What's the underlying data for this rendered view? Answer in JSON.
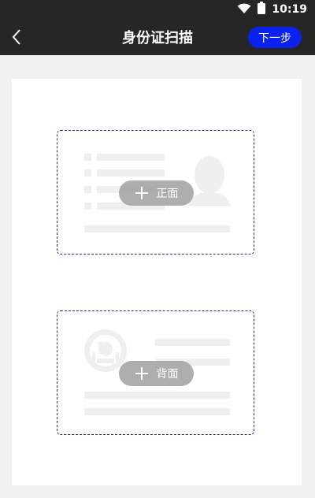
{
  "status": {
    "time": "10:19",
    "wifi_icon": "wifi-icon",
    "battery_icon": "battery-icon"
  },
  "header": {
    "back_icon": "chevron-left-icon",
    "title": "身份证扫描",
    "next_label": "下一步"
  },
  "id_front": {
    "label": "正面",
    "icon": "plus-icon",
    "illustration": "portrait-silhouette"
  },
  "id_back": {
    "label": "背面",
    "icon": "plus-icon",
    "illustration": "national-emblem"
  },
  "colors": {
    "header_bg": "#262626",
    "accent": "#0b22ee",
    "dashed_border": "#1f2e8a",
    "placeholder_lines": "#efefef",
    "pill_bg": "#a0a0a0"
  }
}
